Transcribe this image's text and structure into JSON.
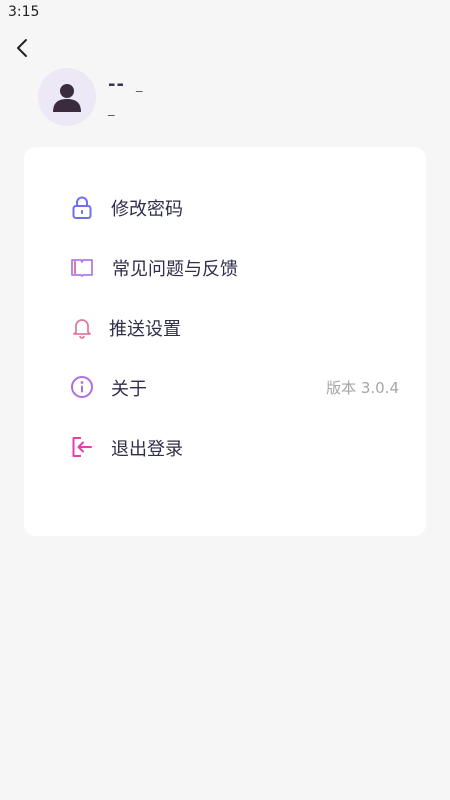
{
  "status_bar": {
    "time": "3:15"
  },
  "profile": {
    "name": "--",
    "extra": "_",
    "subtitle": "_"
  },
  "menu": [
    {
      "id": "change-password",
      "label": "修改密码",
      "icon": "lock-icon"
    },
    {
      "id": "faq-feedback",
      "label": "常见问题与反馈",
      "icon": "book-icon"
    },
    {
      "id": "push-settings",
      "label": "推送设置",
      "icon": "bell-icon"
    },
    {
      "id": "about",
      "label": "关于",
      "value": "版本 3.0.4",
      "icon": "info-icon"
    },
    {
      "id": "logout",
      "label": "退出登录",
      "icon": "logout-icon"
    }
  ],
  "colors": {
    "accent_lock": "#6e6ef0",
    "accent_book": "#b07be8",
    "accent_bell": "#e07ca0",
    "accent_info": "#b06fe0",
    "accent_logout": "#e040b0"
  }
}
